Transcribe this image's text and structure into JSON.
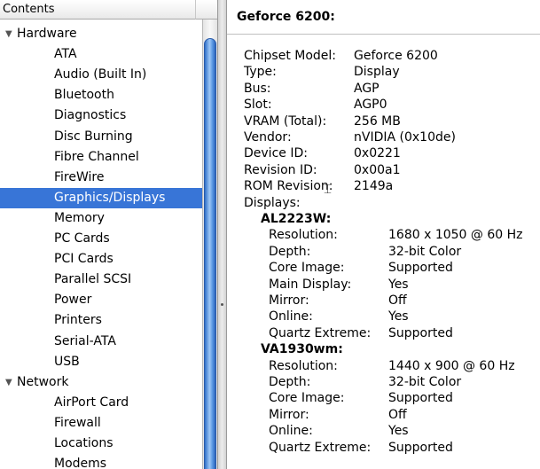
{
  "sidebar": {
    "header": "Contents",
    "groups": [
      {
        "label": "Hardware",
        "items": [
          "ATA",
          "Audio (Built In)",
          "Bluetooth",
          "Diagnostics",
          "Disc Burning",
          "Fibre Channel",
          "FireWire",
          "Graphics/Displays",
          "Memory",
          "PC Cards",
          "PCI Cards",
          "Parallel SCSI",
          "Power",
          "Printers",
          "Serial-ATA",
          "USB"
        ]
      },
      {
        "label": "Network",
        "items": [
          "AirPort Card",
          "Firewall",
          "Locations",
          "Modems"
        ]
      }
    ],
    "selected_item": "Graphics/Displays"
  },
  "detail": {
    "title": "Geforce 6200:",
    "fields": [
      {
        "label": "Chipset Model:",
        "value": "Geforce 6200"
      },
      {
        "label": "Type:",
        "value": "Display"
      },
      {
        "label": "Bus:",
        "value": "AGP"
      },
      {
        "label": "Slot:",
        "value": "AGP0"
      },
      {
        "label": "VRAM (Total):",
        "value": "256 MB"
      },
      {
        "label": "Vendor:",
        "value": "nVIDIA (0x10de)"
      },
      {
        "label": "Device ID:",
        "value": "0x0221"
      },
      {
        "label": "Revision ID:",
        "value": "0x00a1"
      },
      {
        "label": "ROM Revision:",
        "value": "2149a"
      }
    ],
    "displays_label": "Displays:",
    "displays": [
      {
        "name": "AL2223W:",
        "fields": [
          {
            "label": "Resolution:",
            "value": "1680 x 1050 @ 60 Hz"
          },
          {
            "label": "Depth:",
            "value": "32-bit Color"
          },
          {
            "label": "Core Image:",
            "value": "Supported"
          },
          {
            "label": "Main Display:",
            "value": "Yes"
          },
          {
            "label": "Mirror:",
            "value": "Off"
          },
          {
            "label": "Online:",
            "value": "Yes"
          },
          {
            "label": "Quartz Extreme:",
            "value": "Supported"
          }
        ]
      },
      {
        "name": "VA1930wm:",
        "fields": [
          {
            "label": "Resolution:",
            "value": "1440 x 900 @ 60 Hz"
          },
          {
            "label": "Depth:",
            "value": "32-bit Color"
          },
          {
            "label": "Core Image:",
            "value": "Supported"
          },
          {
            "label": "Mirror:",
            "value": "Off"
          },
          {
            "label": "Online:",
            "value": "Yes"
          },
          {
            "label": "Quartz Extreme:",
            "value": "Supported"
          }
        ]
      }
    ]
  },
  "colors": {
    "selection": "#3875d7",
    "scroll_thumb": "#5d9ae4"
  },
  "icons": {
    "disclosure": "disclosure-triangle-icon",
    "cursor": "text-cursor-icon"
  }
}
